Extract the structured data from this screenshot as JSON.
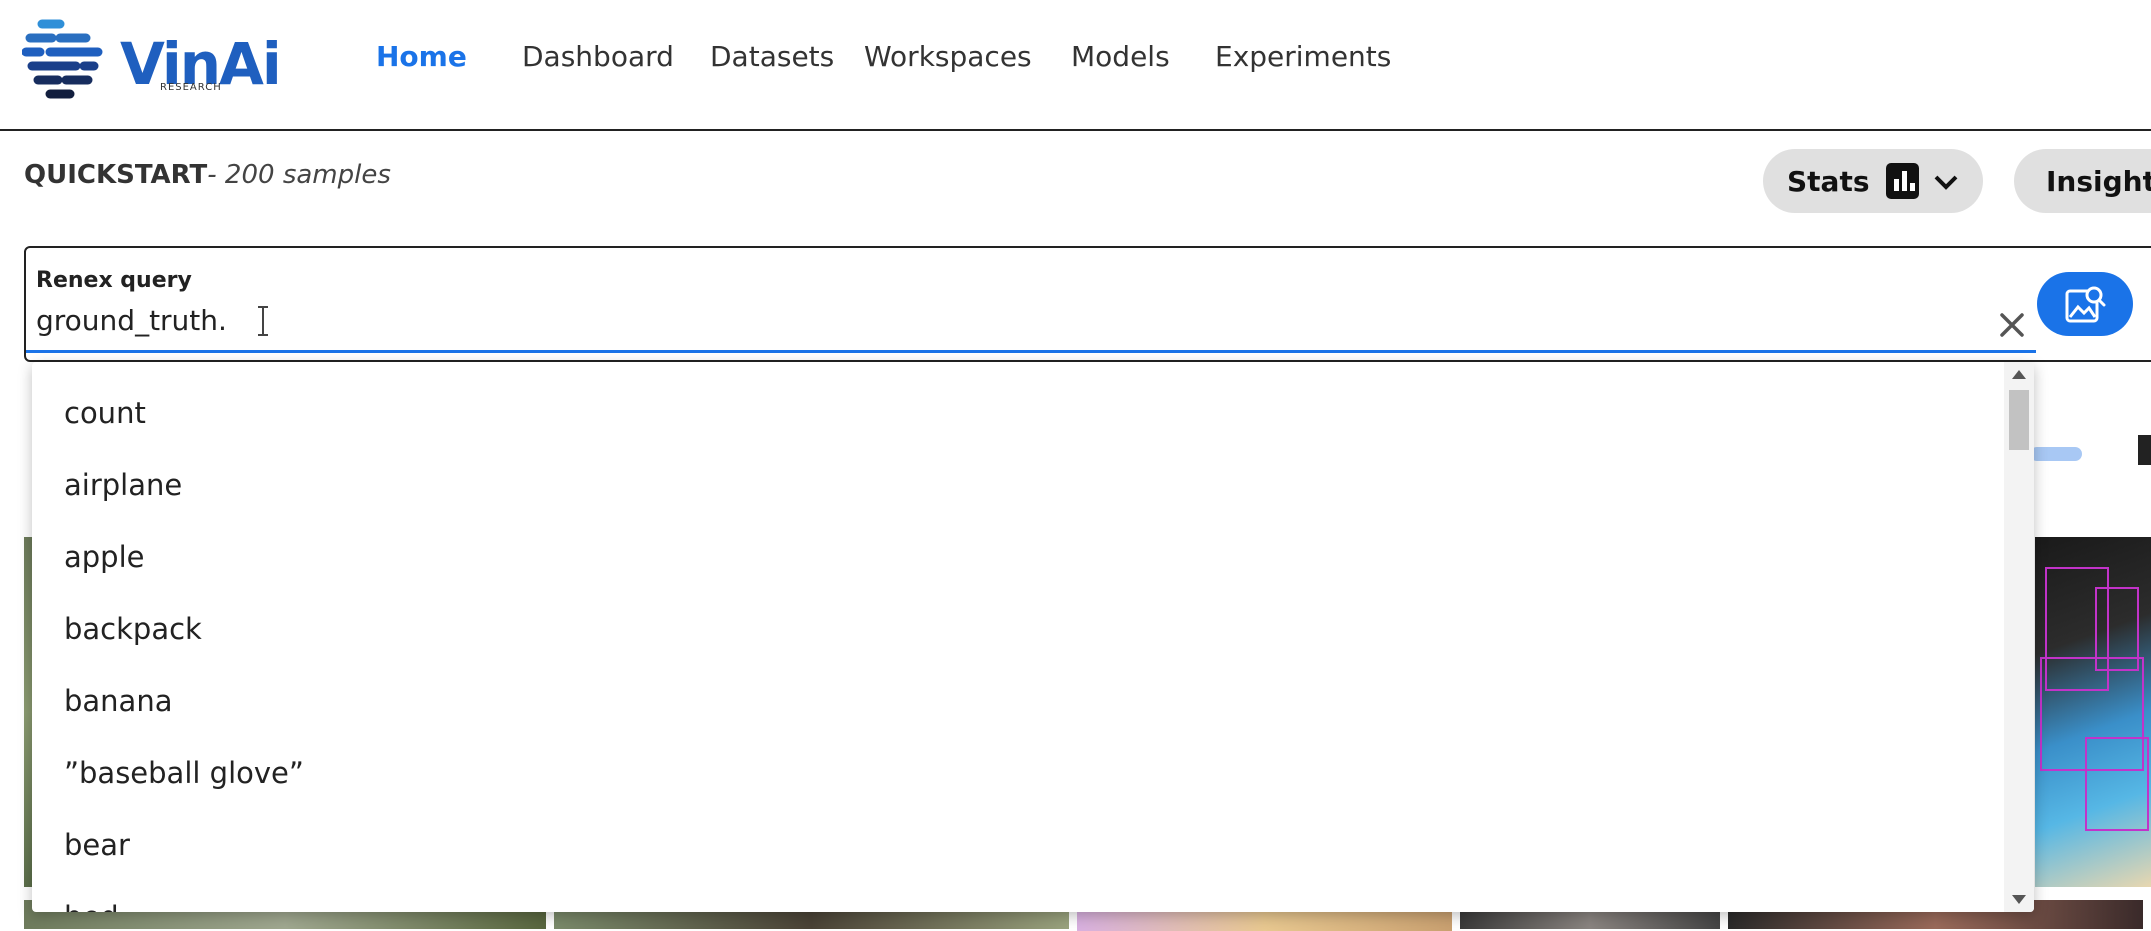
{
  "header": {
    "logo_text": "VinAi",
    "logo_subtext": "RESEARCH",
    "nav": [
      {
        "label": "Home",
        "active": true
      },
      {
        "label": "Dashboard",
        "active": false
      },
      {
        "label": "Datasets",
        "active": false
      },
      {
        "label": "Workspaces",
        "active": false
      },
      {
        "label": "Models",
        "active": false
      },
      {
        "label": "Experiments",
        "active": false
      }
    ]
  },
  "dataset": {
    "name": "QUICKSTART",
    "sample_count": "- 200 samples"
  },
  "toolbar": {
    "stats_label": "Stats",
    "insights_label": "Insights"
  },
  "query": {
    "label": "Renex query",
    "value": "ground_truth."
  },
  "dropdown": {
    "options": [
      "count",
      "airplane",
      "apple",
      "backpack",
      "banana",
      "”baseball glove”",
      "bear",
      "bed"
    ]
  },
  "colors": {
    "accent": "#1a73e8",
    "logo": "#1f5fbf",
    "pill_bg": "#e0e0e0",
    "bbox": "#c233c9"
  },
  "icons": {
    "stats": "bar-chart-icon",
    "stats_toggle": "chevron-down-icon",
    "clear": "close-icon",
    "image_search": "image-search-icon"
  }
}
